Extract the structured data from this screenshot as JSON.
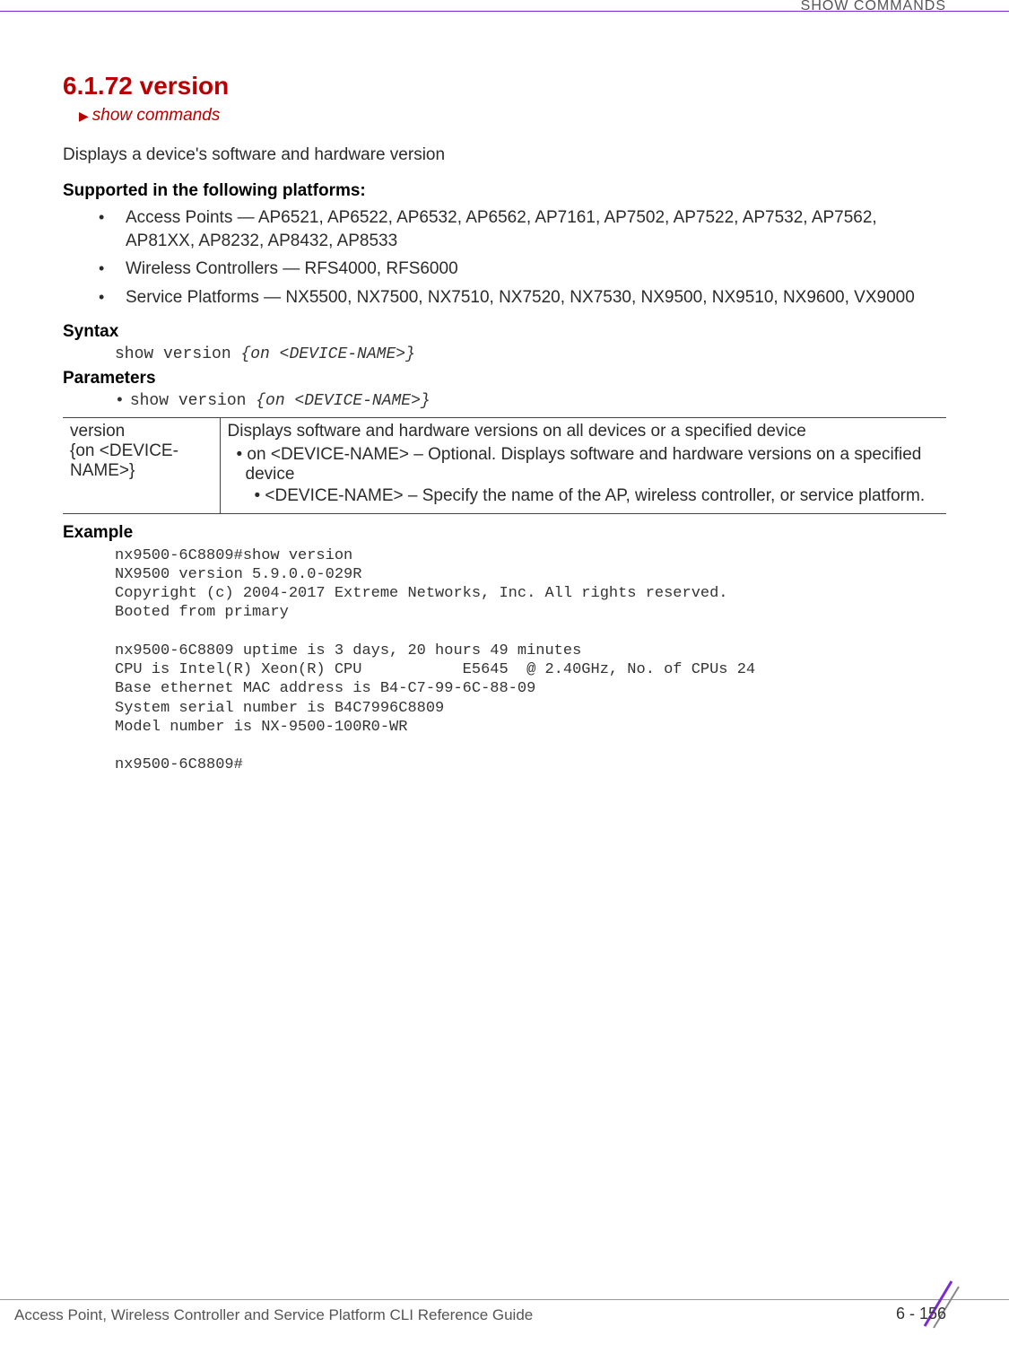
{
  "header": {
    "category": "SHOW COMMANDS"
  },
  "section": {
    "number_title": "6.1.72 version",
    "breadcrumb": "show commands",
    "intro": "Displays a device's software and hardware version"
  },
  "supported": {
    "heading": "Supported in the following platforms:",
    "items": [
      "Access Points — AP6521, AP6522, AP6532, AP6562, AP7161, AP7502, AP7522, AP7532, AP7562, AP81XX, AP8232, AP8432, AP8533",
      "Wireless Controllers — RFS4000, RFS6000",
      "Service Platforms — NX5500, NX7500, NX7510, NX7520, NX7530, NX9500, NX9510, NX9600, VX9000"
    ]
  },
  "syntax": {
    "heading": "Syntax",
    "cmd_plain": "show version ",
    "cmd_italic": "{on <DEVICE-NAME>}"
  },
  "parameters": {
    "heading": "Parameters",
    "line_plain": "show version ",
    "line_italic": "{on <DEVICE-NAME>}",
    "table": {
      "left": "version\n{on <DEVICE-NAME>}",
      "right_main": "Displays software and hardware versions on all devices or a specified device",
      "right_sub": "• on <DEVICE-NAME> – Optional. Displays software and hardware versions on a specified device",
      "right_sub2": "• <DEVICE-NAME> – Specify the name of the AP, wireless controller, or service platform."
    }
  },
  "example": {
    "heading": "Example",
    "text": "nx9500-6C8809#show version\nNX9500 version 5.9.0.0-029R\nCopyright (c) 2004-2017 Extreme Networks, Inc. All rights reserved.\nBooted from primary\n\nnx9500-6C8809 uptime is 3 days, 20 hours 49 minutes\nCPU is Intel(R) Xeon(R) CPU           E5645  @ 2.40GHz, No. of CPUs 24\nBase ethernet MAC address is B4-C7-99-6C-88-09\nSystem serial number is B4C7996C8809\nModel number is NX-9500-100R0-WR\n\nnx9500-6C8809#"
  },
  "footer": {
    "guide": "Access Point, Wireless Controller and Service Platform CLI Reference Guide",
    "page": "6 - 156"
  }
}
